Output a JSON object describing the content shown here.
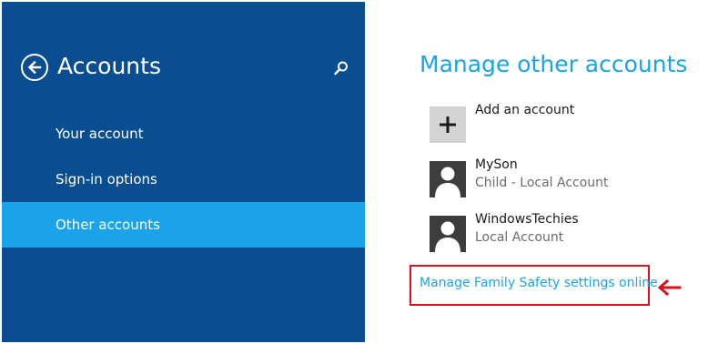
{
  "sidebar": {
    "title": "Accounts",
    "items": [
      {
        "label": "Your account",
        "active": false
      },
      {
        "label": "Sign-in options",
        "active": false
      },
      {
        "label": "Other accounts",
        "active": true
      }
    ],
    "back_icon": "back-arrow-icon",
    "search_icon": "search-icon"
  },
  "main": {
    "title": "Manage other accounts",
    "add_account": {
      "label": "Add an account",
      "icon": "plus-icon"
    },
    "accounts": [
      {
        "name": "MySon",
        "type": "Child - Local Account",
        "icon": "user-avatar-icon"
      },
      {
        "name": "WindowsTechies",
        "type": "Local Account",
        "icon": "user-avatar-icon"
      }
    ],
    "family_safety_link": "Manage Family Safety settings online"
  },
  "annotation": {
    "highlight_color": "#d9121d",
    "arrow_icon": "red-left-arrow-icon"
  },
  "colors": {
    "sidebar_bg": "#0a4d91",
    "accent": "#1aa3e8",
    "active_item_bg": "#1aa3e8"
  }
}
